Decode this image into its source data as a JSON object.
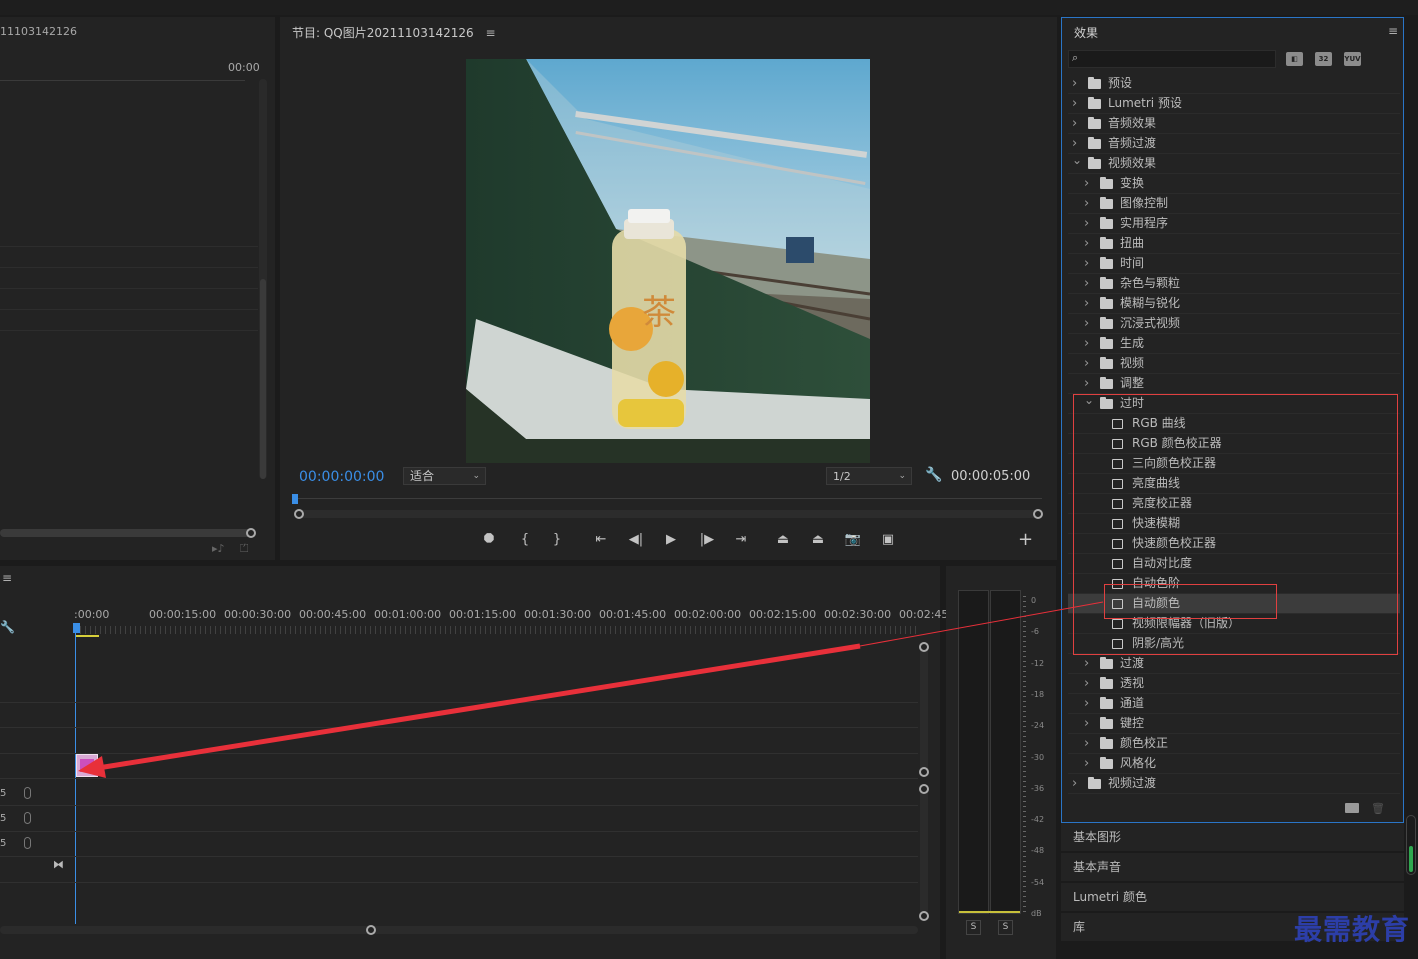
{
  "source": {
    "title": "11103142126",
    "timecode": "00:00"
  },
  "program": {
    "title": "节目: QQ图片20211103142126",
    "menu_glyph": "≡",
    "current_time": "00:00:00:00",
    "zoom": "适合",
    "resolution": "1/2",
    "duration": "00:00:05:00",
    "controls": [
      {
        "name": "add-marker-icon",
        "glyph": "⯃"
      },
      {
        "name": "mark-in-icon",
        "glyph": "{"
      },
      {
        "name": "mark-out-icon",
        "glyph": "}"
      },
      {
        "name": "go-to-in-icon",
        "glyph": "⇤"
      },
      {
        "name": "step-back-icon",
        "glyph": "◀|"
      },
      {
        "name": "play-icon",
        "glyph": "▶"
      },
      {
        "name": "step-forward-icon",
        "glyph": "|▶"
      },
      {
        "name": "go-to-out-icon",
        "glyph": "⇥"
      },
      {
        "name": "lift-icon",
        "glyph": "⏏"
      },
      {
        "name": "extract-icon",
        "glyph": "⏏"
      },
      {
        "name": "export-frame-icon",
        "glyph": "📷"
      },
      {
        "name": "comparison-view-icon",
        "glyph": "▣"
      }
    ],
    "add_glyph": "+"
  },
  "timeline": {
    "menu_glyph": "≡",
    "ruler": [
      ":00:00",
      "00:00:15:00",
      "00:00:30:00",
      "00:00:45:00",
      "00:01:00:00",
      "00:01:15:00",
      "00:01:30:00",
      "00:01:45:00",
      "00:02:00:00",
      "00:02:15:00",
      "00:02:30:00",
      "00:02:45:"
    ],
    "audio_tracks": [
      "5",
      "5",
      "5"
    ]
  },
  "meter": {
    "scale": [
      "0",
      "-6",
      "-12",
      "-18",
      "-24",
      "-30",
      "-36",
      "-42",
      "-48",
      "-54",
      "dB"
    ],
    "solo": [
      "S",
      "S"
    ]
  },
  "effects": {
    "title": "效果",
    "menu_glyph": "≡",
    "tool_icons": [
      "32",
      "YUV"
    ],
    "tree": [
      {
        "label": "预设",
        "level": 0,
        "expanded": false,
        "kind": "folder-star"
      },
      {
        "label": "Lumetri 预设",
        "level": 0,
        "expanded": false,
        "kind": "folder-star"
      },
      {
        "label": "音频效果",
        "level": 0,
        "expanded": false,
        "kind": "folder"
      },
      {
        "label": "音频过渡",
        "level": 0,
        "expanded": false,
        "kind": "folder"
      },
      {
        "label": "视频效果",
        "level": 0,
        "expanded": true,
        "kind": "folder"
      },
      {
        "label": "变换",
        "level": 1,
        "expanded": false,
        "kind": "folder"
      },
      {
        "label": "图像控制",
        "level": 1,
        "expanded": false,
        "kind": "folder"
      },
      {
        "label": "实用程序",
        "level": 1,
        "expanded": false,
        "kind": "folder"
      },
      {
        "label": "扭曲",
        "level": 1,
        "expanded": false,
        "kind": "folder"
      },
      {
        "label": "时间",
        "level": 1,
        "expanded": false,
        "kind": "folder"
      },
      {
        "label": "杂色与颗粒",
        "level": 1,
        "expanded": false,
        "kind": "folder"
      },
      {
        "label": "模糊与锐化",
        "level": 1,
        "expanded": false,
        "kind": "folder"
      },
      {
        "label": "沉浸式视频",
        "level": 1,
        "expanded": false,
        "kind": "folder"
      },
      {
        "label": "生成",
        "level": 1,
        "expanded": false,
        "kind": "folder"
      },
      {
        "label": "视频",
        "level": 1,
        "expanded": false,
        "kind": "folder"
      },
      {
        "label": "调整",
        "level": 1,
        "expanded": false,
        "kind": "folder"
      },
      {
        "label": "过时",
        "level": 1,
        "expanded": true,
        "kind": "folder"
      },
      {
        "label": "RGB 曲线",
        "level": 2,
        "kind": "effect"
      },
      {
        "label": "RGB 颜色校正器",
        "level": 2,
        "kind": "effect"
      },
      {
        "label": "三向颜色校正器",
        "level": 2,
        "kind": "effect"
      },
      {
        "label": "亮度曲线",
        "level": 2,
        "kind": "effect"
      },
      {
        "label": "亮度校正器",
        "level": 2,
        "kind": "effect"
      },
      {
        "label": "快速模糊",
        "level": 2,
        "kind": "effect"
      },
      {
        "label": "快速颜色校正器",
        "level": 2,
        "kind": "effect"
      },
      {
        "label": "自动对比度",
        "level": 2,
        "kind": "effect"
      },
      {
        "label": "自动色阶",
        "level": 2,
        "kind": "effect"
      },
      {
        "label": "自动颜色",
        "level": 2,
        "kind": "effect",
        "selected": true
      },
      {
        "label": "视频限幅器（旧版）",
        "level": 2,
        "kind": "effect"
      },
      {
        "label": "阴影/高光",
        "level": 2,
        "kind": "effect"
      },
      {
        "label": "过渡",
        "level": 1,
        "expanded": false,
        "kind": "folder"
      },
      {
        "label": "透视",
        "level": 1,
        "expanded": false,
        "kind": "folder"
      },
      {
        "label": "通道",
        "level": 1,
        "expanded": false,
        "kind": "folder"
      },
      {
        "label": "键控",
        "level": 1,
        "expanded": false,
        "kind": "folder"
      },
      {
        "label": "颜色校正",
        "level": 1,
        "expanded": false,
        "kind": "folder"
      },
      {
        "label": "风格化",
        "level": 1,
        "expanded": false,
        "kind": "folder"
      },
      {
        "label": "视频过渡",
        "level": 0,
        "expanded": false,
        "kind": "folder"
      }
    ]
  },
  "panels": {
    "essential_graphics": "基本图形",
    "essential_sound": "基本声音",
    "lumetri_color": "Lumetri 颜色",
    "libraries": "库"
  },
  "watermark": "最需教育",
  "colors": {
    "accent_blue": "#3a8ee6",
    "highlight_red": "#e04040",
    "annotation_arrow": "#e8303a"
  }
}
